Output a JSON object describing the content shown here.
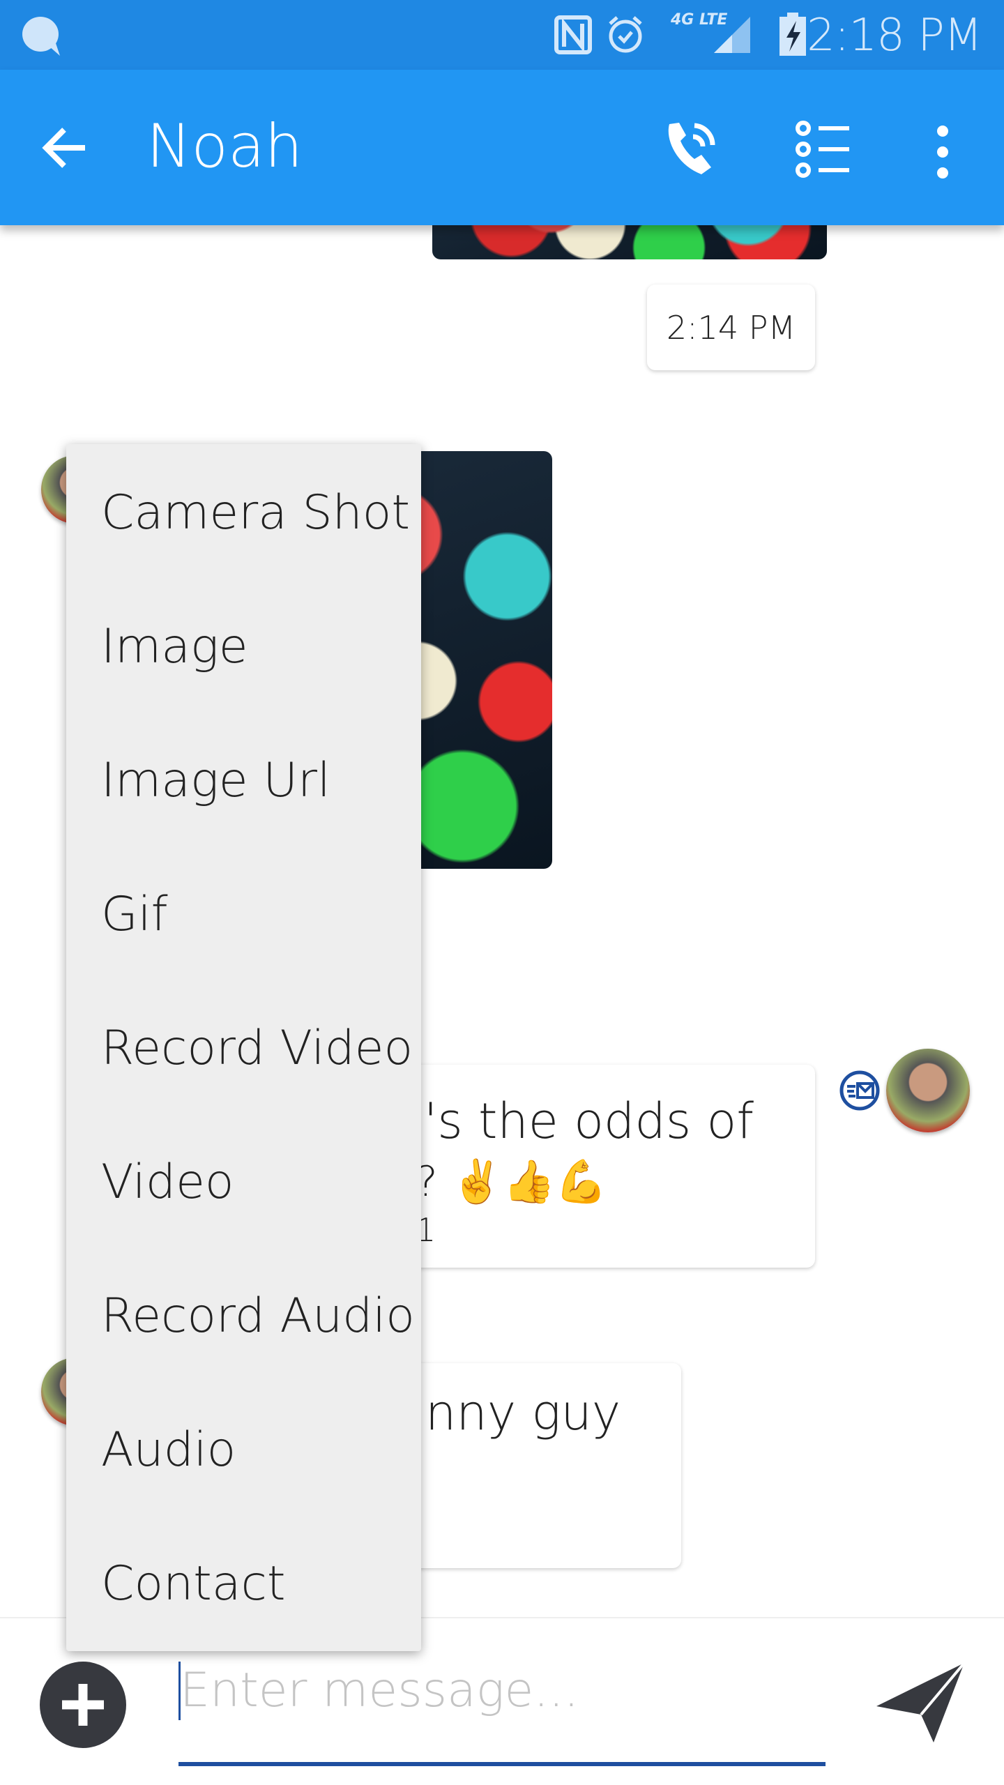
{
  "status_bar": {
    "time": "2:18 PM",
    "icons": [
      "chat-bubble-icon",
      "nfc-icon",
      "alarm-icon",
      "4g-lte-icon",
      "signal-icon",
      "battery-charging-icon"
    ],
    "network_label": "4G LTE"
  },
  "app_bar": {
    "title": "Noah",
    "icons": [
      "back-arrow-icon",
      "phone-call-icon",
      "list-options-icon",
      "more-vert-icon"
    ],
    "color": "#2196f3"
  },
  "chat": {
    "sent_timestamp": "2:14 PM",
    "messages": [
      {
        "lines": [
          "'s the odds of",
          "? ✌️👍💪",
          "1"
        ],
        "sender": "me"
      },
      {
        "lines": [
          "nny guy"
        ],
        "sender": "other"
      }
    ]
  },
  "attach_menu": {
    "items": [
      "Camera Shot",
      "Image",
      "Image Url",
      "Gif",
      "Record Video",
      "Video",
      "Record Audio",
      "Audio",
      "Contact"
    ]
  },
  "composer": {
    "placeholder": "Enter message...",
    "accent": "#1e4fa0"
  }
}
